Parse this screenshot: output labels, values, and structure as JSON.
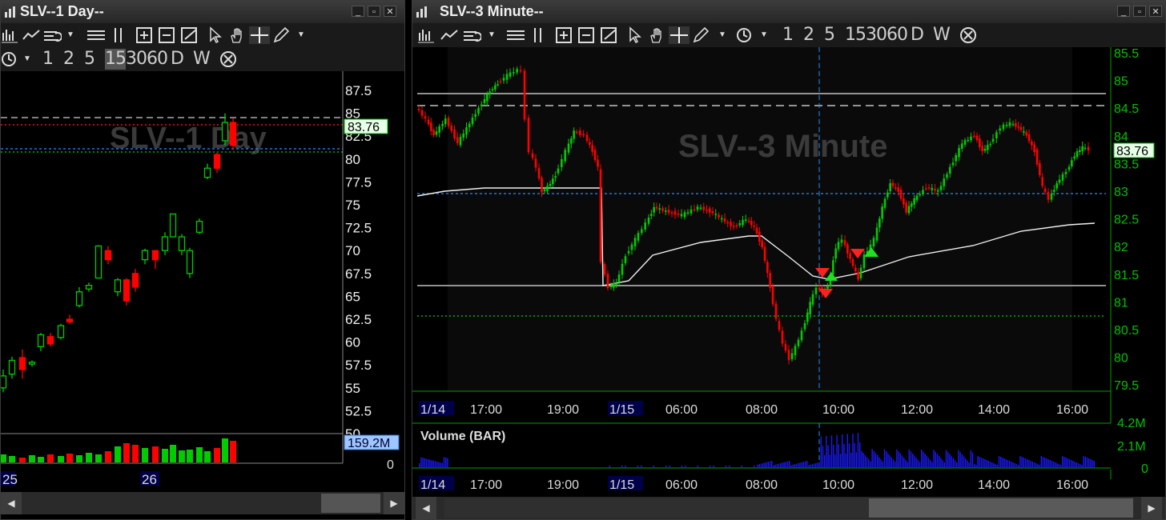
{
  "left_window": {
    "title": "SLV--1 Day--",
    "watermark": "SLV--1 Day",
    "period_buttons": [
      "1",
      "2",
      "5",
      "15",
      "30",
      "60",
      "D",
      "W"
    ],
    "price_axis": [
      "87.5",
      "85",
      "82.5",
      "80",
      "77.5",
      "75",
      "72.5",
      "70",
      "67.5",
      "65",
      "62.5",
      "60",
      "57.5",
      "55",
      "52.5",
      "50"
    ],
    "last_price": "83.76",
    "volume_label": "159.2M",
    "volume_zero": "0",
    "dates": [
      "25",
      "26"
    ]
  },
  "right_window": {
    "title": "SLV--3 Minute--",
    "watermark": "SLV--3 Minute",
    "period_buttons": [
      "1",
      "2",
      "5",
      "15",
      "30",
      "60",
      "D",
      "W"
    ],
    "price_axis": [
      "85.5",
      "85",
      "84.5",
      "84",
      "83.5",
      "83",
      "82.5",
      "82",
      "81.5",
      "81",
      "80.5",
      "80",
      "79.5"
    ],
    "last_price": "83.76",
    "time_labels": [
      "1/14",
      "17:00",
      "19:00",
      "1/15",
      "06:00",
      "08:00",
      "10:00",
      "12:00",
      "14:00",
      "16:00"
    ],
    "volume_title": "Volume (BAR)",
    "volume_axis": [
      "4.2M",
      "2.1M",
      "0"
    ]
  },
  "colors": {
    "up": "#00cc00",
    "down": "#ff0000",
    "axis_text": "#00c000",
    "grid_dash_blue": "#1e90ff",
    "grid_dash_green": "#00d000",
    "volume_bar": "#1a1aff"
  },
  "icons": [
    "bar-chart-icon",
    "line-chart-icon",
    "indicator-icon",
    "horizontal-lines-icon",
    "vertical-lines-icon",
    "zoom-in-icon",
    "zoom-out-icon",
    "zoom-fit-icon",
    "pointer-icon",
    "hand-icon",
    "crosshair-icon",
    "pencil-icon",
    "clock-icon",
    "close-circle-icon"
  ]
}
